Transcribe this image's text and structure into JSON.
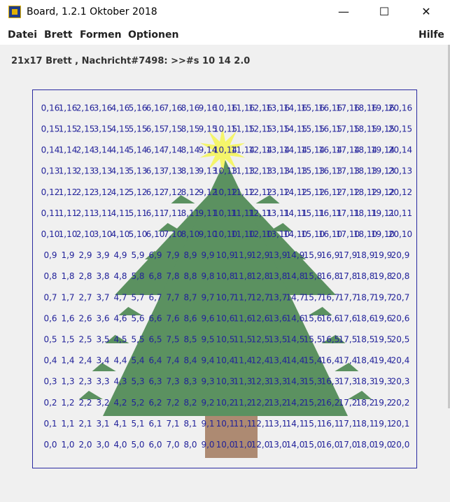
{
  "window": {
    "title": "Board, 1.2.1 Oktober 2018",
    "controls": {
      "minimize": "—",
      "maximize": "☐",
      "close": "✕"
    }
  },
  "menu": {
    "left": [
      "Datei",
      "Brett",
      "Formen",
      "Optionen"
    ],
    "right": "Hilfe"
  },
  "status_text": "21x17 Brett , Nachricht#7498: >>#s 10 14 2.0",
  "board": {
    "cols": 21,
    "rows": 17,
    "text_color": "#22229a",
    "border_color": "#2a2aa0",
    "tree": {
      "foliage_color": "#5b9160",
      "trunk_color": "#ad8a72",
      "star_color": "#f5f56a"
    }
  }
}
